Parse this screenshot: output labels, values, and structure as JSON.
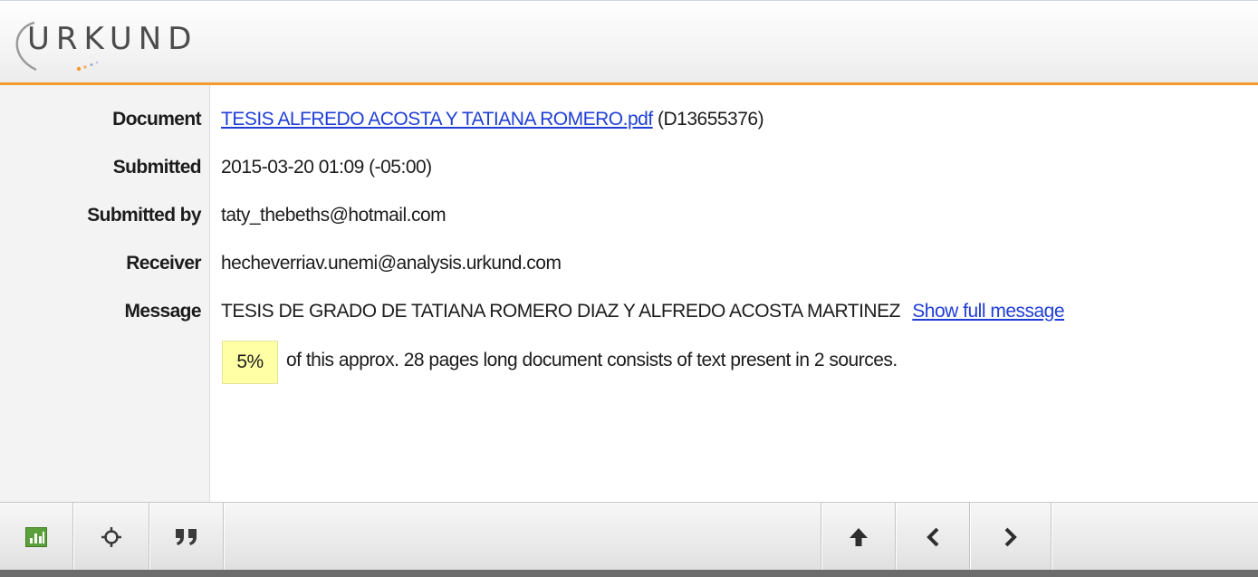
{
  "header": {
    "logo_text": "URKUND"
  },
  "details": {
    "document": {
      "label": "Document",
      "link": "TESIS ALFREDO ACOSTA Y TATIANA ROMERO.pdf",
      "id": "(D13655376)"
    },
    "submitted": {
      "label": "Submitted",
      "value": "2015-03-20 01:09 (-05:00)"
    },
    "submitted_by": {
      "label": "Submitted by",
      "value": "taty_thebeths@hotmail.com"
    },
    "receiver": {
      "label": "Receiver",
      "value": "hecheverriav.unemi@analysis.urkund.com"
    },
    "message": {
      "label": "Message",
      "value": "TESIS DE GRADO DE TATIANA ROMERO DIAZ Y ALFREDO ACOSTA MARTINEZ",
      "show_full": "Show full message"
    }
  },
  "summary": {
    "percentage": "5%",
    "text": "of this approx. 28 pages long document consists of text present in 2 sources."
  },
  "toolbar": {
    "buttons": [
      {
        "icon": "bar-chart-icon",
        "active": true
      },
      {
        "icon": "crosshair-icon"
      },
      {
        "icon": "quote-icon"
      },
      {
        "icon": "arrow-up-icon"
      },
      {
        "icon": "chevron-left-icon"
      },
      {
        "icon": "chevron-right-icon"
      }
    ]
  },
  "colors": {
    "accent": "#f29a2e",
    "link": "#1f3ed6",
    "highlight": "#ffffa6",
    "chart_icon_green": "#5aa13b"
  }
}
